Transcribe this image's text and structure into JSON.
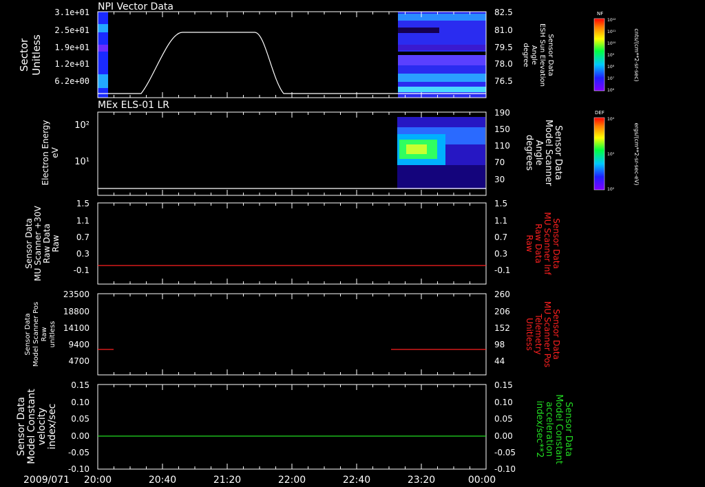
{
  "date_label": "2009/071",
  "time_ticks": [
    "20:00",
    "20:40",
    "21:20",
    "22:00",
    "22:40",
    "23:20",
    "00:00"
  ],
  "colorbars": [
    {
      "title": "NF",
      "unit": "cnts/(cm**2-sr-sec)",
      "ticks": [
        "10¹²",
        "10¹¹",
        "10¹⁰",
        "10⁹",
        "10⁸",
        "10⁷",
        "10⁶"
      ]
    },
    {
      "title": "DEF",
      "unit": "ergs/(cm**2-sr-sec-eV)",
      "ticks": [
        "10⁴",
        "10³",
        "10²"
      ]
    }
  ],
  "chart_data": [
    {
      "type": "heatmap",
      "title": "NPI Vector Data",
      "ylabel": [
        "Sector",
        "Unitless"
      ],
      "yticks": [
        "3.1e+01",
        "2.5e+01",
        "1.9e+01",
        "1.2e+01",
        "6.2e+00"
      ],
      "y2label": [
        "Sensor Data",
        "ESH Sun Elevation",
        "Angle",
        "degree"
      ],
      "y2ticks": [
        "82.5",
        "81.0",
        "79.5",
        "78.0",
        "76.5"
      ],
      "y2lim": [
        75.5,
        82.5
      ],
      "overlay_line": {
        "color": "#ffffff",
        "x": [
          "20:00",
          "20:25",
          "20:45",
          "21:40",
          "22:00",
          "23:20"
        ],
        "y": [
          75.5,
          75.5,
          81.0,
          81.0,
          75.5,
          75.5
        ]
      },
      "data_present": [
        "20:00-20:05",
        "22:59-00:00"
      ]
    },
    {
      "type": "heatmap",
      "title": "MEx ELS-01 LR",
      "ylabel": [
        "Electron Energy",
        "eV"
      ],
      "yticks": [
        "10²",
        "10¹"
      ],
      "ylog": true,
      "y2label": [
        "Sensor Data",
        "Model Scanner",
        "Angle",
        "degrees"
      ],
      "y2ticks": [
        "190",
        "150",
        "110",
        "70",
        "30"
      ],
      "y2lim": [
        0,
        190
      ],
      "overlay_line": {
        "color": "#ffffff",
        "x": [
          "20:00",
          "00:00"
        ],
        "y": [
          3,
          3
        ]
      },
      "data_present": [
        "22:59-00:00"
      ]
    },
    {
      "type": "line",
      "ylabel": [
        "Sensor Data",
        "MU Scanner +30V",
        "Raw Data",
        "Raw"
      ],
      "yticks": [
        "1.5",
        "1.1",
        "0.7",
        "0.3",
        "-0.1"
      ],
      "ylim": [
        -0.4,
        1.5
      ],
      "y2label": [
        "Sensor Data",
        "MU Scanner Inf",
        "Raw Data",
        "Raw"
      ],
      "y2ticks": [
        "1.5",
        "1.1",
        "0.7",
        "0.3",
        "-0.1"
      ],
      "series": [
        {
          "color": "#ff2020",
          "x": [
            "20:00",
            "00:00"
          ],
          "y": [
            0.0,
            0.0
          ]
        }
      ]
    },
    {
      "type": "line",
      "ylabel": [
        "Sensor Data",
        "Model Scanner Pos",
        "Raw",
        "unitless"
      ],
      "yticks": [
        "23500",
        "18800",
        "14100",
        "9400",
        "4700"
      ],
      "ylim": [
        0,
        23500
      ],
      "y2label": [
        "Sensor Data",
        "MU Scanner Pos",
        "Telemetry",
        "Unitless"
      ],
      "y2ticks": [
        "260",
        "206",
        "152",
        "98",
        "44"
      ],
      "y2lim": [
        0,
        260
      ],
      "series": [
        {
          "color": "#ff2020",
          "x": [
            "20:00",
            "20:05"
          ],
          "y": [
            8000,
            8000
          ]
        },
        {
          "color": "#ff2020",
          "x": [
            "22:59",
            "00:00"
          ],
          "y": [
            8000,
            8000
          ]
        }
      ]
    },
    {
      "type": "line",
      "ylabel": [
        "Sensor Data",
        "Model Constant",
        "velocity",
        "index/sec"
      ],
      "yticks": [
        "0.15",
        "0.10",
        "0.05",
        "0.00",
        "-0.05",
        "-0.10"
      ],
      "ylim": [
        -0.1,
        0.15
      ],
      "y2label": [
        "Sensor Data",
        "Model Constant",
        "acceleration",
        "index/sec**2"
      ],
      "y2ticks": [
        "0.15",
        "0.10",
        "0.05",
        "0.00",
        "-0.05",
        "-0.10"
      ],
      "series": [
        {
          "color": "#22dd22",
          "x": [
            "20:00",
            "00:00"
          ],
          "y": [
            0.0,
            0.0
          ]
        }
      ]
    }
  ]
}
